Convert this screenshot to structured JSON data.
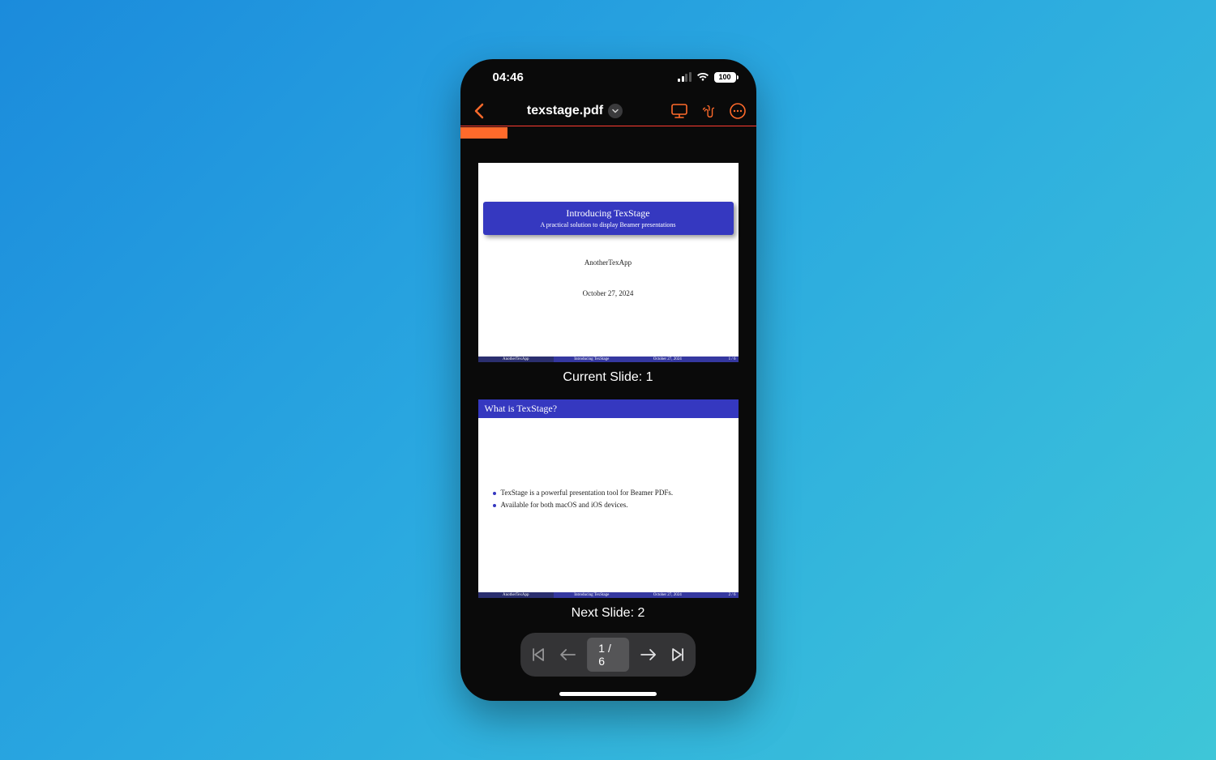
{
  "status": {
    "time": "04:46",
    "battery": "100"
  },
  "nav": {
    "filename": "texstage.pdf"
  },
  "progress": {
    "fill_percent": 16
  },
  "slides": {
    "current_caption": "Current Slide: 1",
    "next_caption": "Next Slide: 2",
    "s1": {
      "title": "Introducing TexStage",
      "subtitle": "A practical solution to display Beamer presentations",
      "author": "AnotherTexApp",
      "date": "October 27, 2024",
      "foot_author": "AnotherTexApp",
      "foot_title": "Introducing TexStage",
      "foot_date": "October 27, 2024",
      "foot_page": "1 / 6"
    },
    "s2": {
      "title": "What is TexStage?",
      "bullet1": "TexStage is a powerful presentation tool for Beamer PDFs.",
      "bullet2": "Available for both macOS and iOS devices.",
      "foot_author": "AnotherTexApp",
      "foot_title": "Introducing TexStage",
      "foot_date": "October 27, 2024",
      "foot_page": "2 / 6"
    }
  },
  "controls": {
    "page_label": "1 / 6"
  }
}
